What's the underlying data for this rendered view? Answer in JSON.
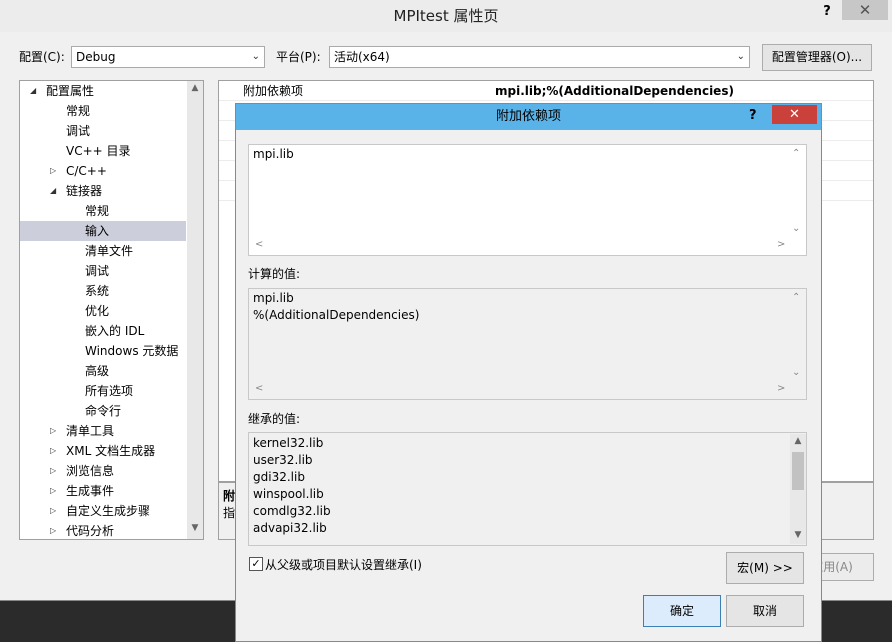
{
  "window": {
    "title": "MPItest 属性页",
    "help": "?",
    "close": "✕"
  },
  "top_bar": {
    "config_label": "配置(C):",
    "config_value": "Debug",
    "platform_label": "平台(P):",
    "platform_value": "活动(x64)",
    "config_manager_button": "配置管理器(O)..."
  },
  "tree": {
    "items": [
      {
        "label": "配置属性",
        "indent": 0,
        "expander": "◢"
      },
      {
        "label": "常规",
        "indent": 1,
        "expander": ""
      },
      {
        "label": "调试",
        "indent": 1,
        "expander": ""
      },
      {
        "label": "VC++ 目录",
        "indent": 1,
        "expander": ""
      },
      {
        "label": "C/C++",
        "indent": 1,
        "expander": "▷"
      },
      {
        "label": "链接器",
        "indent": 1,
        "expander": "◢"
      },
      {
        "label": "常规",
        "indent": 2,
        "expander": ""
      },
      {
        "label": "输入",
        "indent": 2,
        "expander": "",
        "selected": true
      },
      {
        "label": "清单文件",
        "indent": 2,
        "expander": ""
      },
      {
        "label": "调试",
        "indent": 2,
        "expander": ""
      },
      {
        "label": "系统",
        "indent": 2,
        "expander": ""
      },
      {
        "label": "优化",
        "indent": 2,
        "expander": ""
      },
      {
        "label": "嵌入的 IDL",
        "indent": 2,
        "expander": ""
      },
      {
        "label": "Windows 元数据",
        "indent": 2,
        "expander": ""
      },
      {
        "label": "高级",
        "indent": 2,
        "expander": ""
      },
      {
        "label": "所有选项",
        "indent": 2,
        "expander": ""
      },
      {
        "label": "命令行",
        "indent": 2,
        "expander": ""
      },
      {
        "label": "清单工具",
        "indent": 1,
        "expander": "▷"
      },
      {
        "label": "XML 文档生成器",
        "indent": 1,
        "expander": "▷"
      },
      {
        "label": "浏览信息",
        "indent": 1,
        "expander": "▷"
      },
      {
        "label": "生成事件",
        "indent": 1,
        "expander": "▷"
      },
      {
        "label": "自定义生成步骤",
        "indent": 1,
        "expander": "▷"
      },
      {
        "label": "代码分析",
        "indent": 1,
        "expander": "▷"
      }
    ]
  },
  "property_grid": {
    "name": "附加依赖项",
    "value": "mpi.lib;%(AdditionalDependencies)"
  },
  "description": {
    "title": "附",
    "text": "指"
  },
  "bottom_buttons": {
    "apply": "应用(A)"
  },
  "dialog": {
    "title": "附加依赖项",
    "help": "?",
    "close": "✕",
    "edit_text": "mpi.lib",
    "computed_label": "计算的值:",
    "computed_lines": [
      "mpi.lib",
      "%(AdditionalDependencies)"
    ],
    "inherited_label": "继承的值:",
    "inherited_lines": [
      "kernel32.lib",
      "user32.lib",
      "gdi32.lib",
      "winspool.lib",
      "comdlg32.lib",
      "advapi32.lib"
    ],
    "inherit_checkbox_label": "从父级或项目默认设置继承(I)",
    "inherit_checked": true,
    "macro_button": "宏(M) >>",
    "ok_button": "确定",
    "cancel_button": "取消"
  },
  "colors": {
    "dialog_title_bar": "#5ab3e8",
    "close_button_red": "#c9413a",
    "tree_selection": "#cccedb"
  }
}
